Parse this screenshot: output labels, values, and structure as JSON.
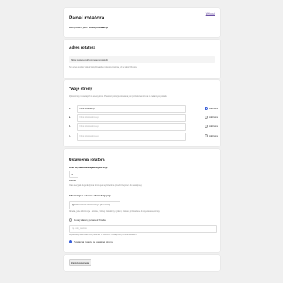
{
  "header": {
    "title": "Panel rotatora",
    "logout_label": "Wyloguj",
    "logged_prefix": "Zalogowano jako:",
    "user_email": "kolo@cokarer.pl"
  },
  "address": {
    "title": "Adres rotatora",
    "url": "https://kotenet.pl/rotpm/generowstyb/",
    "hint": "Ten adres możesz wkleić wszędzie adres rotatora zostanie już w całość Rotora."
  },
  "pages": {
    "title": "Twoje strony",
    "hint": "Wpisz strony rotowanych w adresy stron. Pierwsza pozycja rotowana jest początkowa strona na reklamy w portalu.",
    "active_label": "Aktywna",
    "rows": [
      {
        "num": "1.",
        "value": "https://cokarer.pl",
        "placeholder": "",
        "active": true
      },
      {
        "num": "2.",
        "value": "",
        "placeholder": "https://www.strona.pl",
        "active": false
      },
      {
        "num": "3.",
        "value": "",
        "placeholder": "https://www.strona.pl",
        "active": false
      },
      {
        "num": "4.",
        "value": "",
        "placeholder": "https://www.strona.pl",
        "active": false
      }
    ]
  },
  "settings": {
    "title": "Ustawienia rotatora",
    "time_label": "Czas wyświetlania jednej strony:",
    "time_value": "6",
    "time_unit": "sekund",
    "time_hint": "Czas (sec) jak długo aktywna strona jest wyświetlona przed przejściem do następnej.",
    "info_label": "Informacja o stronie odwiedzającej:",
    "info_select": "Przekierowanie klasterownym (zalecane)",
    "info_hint": "Określa, jakie informacje o stronie, z której zostaliśmy wysłani, zostaną przekazane do wyświetlanej strony.",
    "param_label": "Dodaj własny parametr źródła",
    "param_placeholder": "np. utm_source",
    "param_hint": "Dopisywany automatycznie parametr z adresem źródła przed przekierowaniem.",
    "rotate_label": "Powtarzaj rotację po ostatniej stronie"
  },
  "footer": {
    "save_label": "Zapisz ustawienia"
  }
}
